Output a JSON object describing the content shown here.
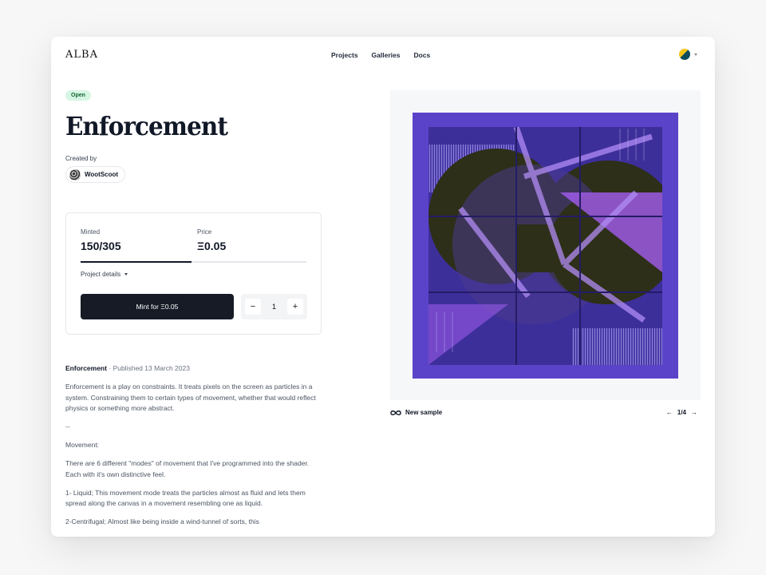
{
  "header": {
    "logo": "ALBA",
    "nav": [
      "Projects",
      "Galleries",
      "Docs"
    ]
  },
  "project": {
    "status": "Open",
    "title": "Enforcement",
    "created_by_label": "Created by",
    "creator": "WootScoot"
  },
  "mint": {
    "minted_label": "Minted",
    "minted_value": "150/305",
    "price_label": "Price",
    "price_value": "Ξ0.05",
    "progress_fraction": 0.4918,
    "details_label": "Project details",
    "button_label": "Mint for Ξ0.05",
    "quantity": "1",
    "minus": "−",
    "plus": "+"
  },
  "description": {
    "name": "Enforcement",
    "separator": "·",
    "published": "Published 13 March 2023",
    "paragraphs": [
      "Enforcement is a play on constraints. It treats pixels on the screen as particles in a system. Constraining them to certain types of movement, whether that would reflect physics or something more abstract.",
      "--",
      "Movement:",
      "There are 6 different \"modes\" of movement that I've programmed into the shader. Each with it's own distinctive feel.",
      "1- Liquid; This movement mode treats the particles almost as fluid and lets them spread along the canvas in a movement resembling one as liquid.",
      "2-Centrifugal; Almost like being inside a wind-tunnel of sorts, this"
    ]
  },
  "gallery": {
    "new_sample_label": "New sample",
    "page_indicator": "1/4",
    "prev": "←",
    "next": "→"
  },
  "colors": {
    "accent_dark": "#161b26",
    "open_badge_bg": "#d7f5e3",
    "art_bg": "#5b43c9",
    "art_fill": "#2d2f18",
    "art_highlight": "#a35cf0"
  }
}
